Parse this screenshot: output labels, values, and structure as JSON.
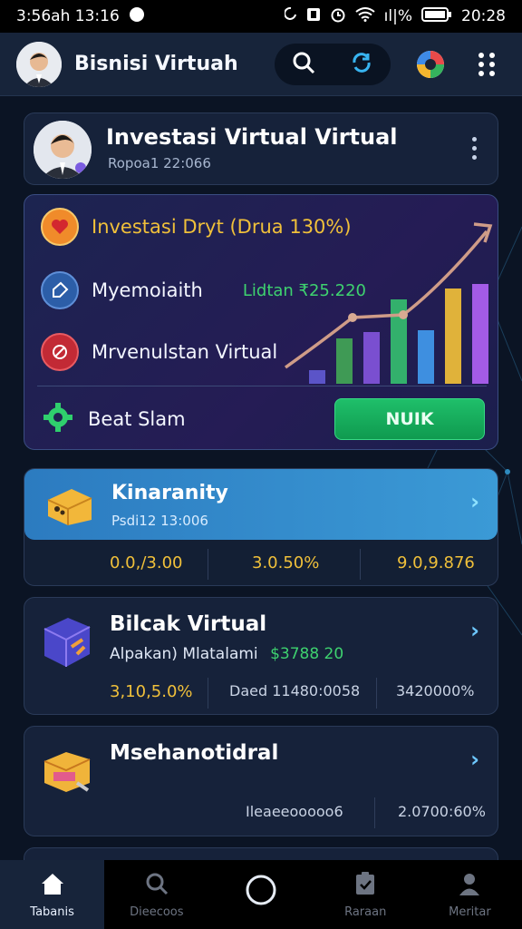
{
  "status_bar": {
    "left_text": "3:56ah 13:16",
    "signal_text": "ıl|%",
    "time": "20:28"
  },
  "app_bar": {
    "title": "Bisnisi Virtuah",
    "icons": [
      "search-icon",
      "sync-icon",
      "app-logo-icon",
      "more-vertical-icon"
    ]
  },
  "profile_card": {
    "title": "Investasi Virtual Virtual",
    "subtitle": "Ropoa1 22:066"
  },
  "invest_card": {
    "rows": [
      {
        "label": "Investasi Dryt (Drua 130%)",
        "icon": "heart-badge-icon"
      },
      {
        "label": "Myemoiaith",
        "value": "Lidtan ₹25.220",
        "icon": "tag-icon"
      },
      {
        "label": "Mrvenulstan Virtual",
        "icon": "block-icon"
      }
    ],
    "footer_label": "Beat Slam",
    "action_label": "NUIK",
    "chart_bars": [
      {
        "color": "#5b54c8",
        "level": 0.15
      },
      {
        "color": "#3f9a55",
        "level": 0.5
      },
      {
        "color": "#7a4fd0",
        "level": 0.57
      },
      {
        "color": "#33b06c",
        "level": 0.93
      },
      {
        "color": "#3e8fe0",
        "level": 0.59
      },
      {
        "color": "#e0b23a",
        "level": 1.05
      },
      {
        "color": "#a35be6",
        "level": 1.1
      }
    ]
  },
  "list_cards": [
    {
      "title": "Kinaranity",
      "subtitle": "Psdi12 13:006",
      "stats": [
        "0.0,/3.00",
        "3.0.50%",
        "9.0,9.876"
      ],
      "icon": "crate-icon"
    },
    {
      "title": "Bilcak Virtual",
      "subtitle": "Alpakan) Mlatalami",
      "highlight": "$3788 20",
      "stats": [
        "3,10,5.0%",
        "Daed 11480:0058",
        "3420000%"
      ],
      "icon": "cube-icon"
    },
    {
      "title": "Msehanotidral",
      "stats": [
        "Ileaeeooooo6",
        "2.0700:60%"
      ],
      "icon": "toolbox-icon"
    }
  ],
  "bottom_nav": [
    {
      "label": "Tabanis",
      "icon": "home-icon",
      "active": true
    },
    {
      "label": "Dieecoos",
      "icon": "search-icon",
      "active": false
    },
    {
      "label": "",
      "icon": "circle-icon",
      "active": false
    },
    {
      "label": "Raraan",
      "icon": "clipboard-icon",
      "active": false
    },
    {
      "label": "Meritar",
      "icon": "user-icon",
      "active": false
    }
  ],
  "colors": {
    "gold": "#f0c03a",
    "green": "#3ed26f",
    "accent_blue": "#3b9ad6"
  }
}
